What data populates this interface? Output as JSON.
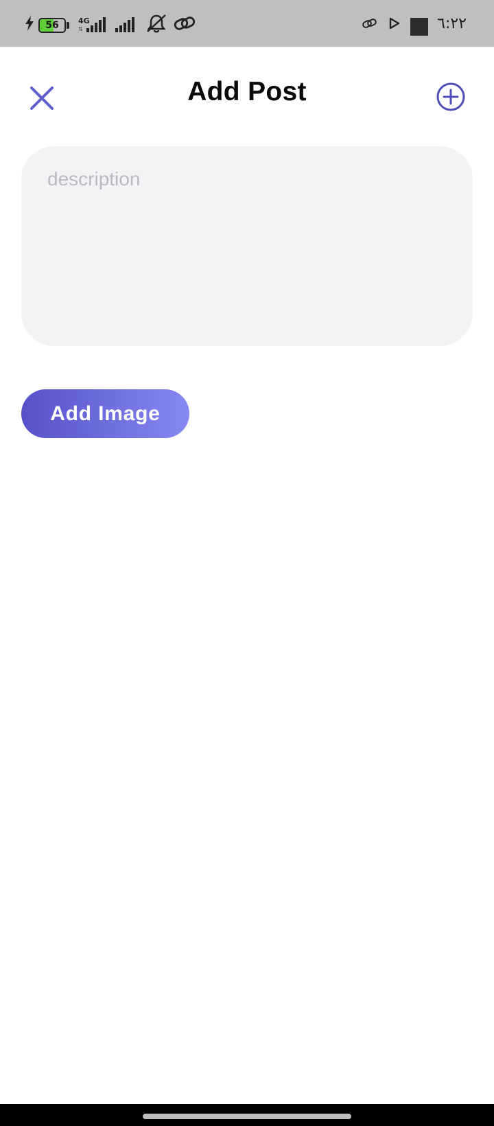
{
  "status_bar": {
    "battery_level": "56",
    "battery_fraction": 0.56,
    "network_type": "4G",
    "clock": "٦:٢٢",
    "icons": [
      "charging-bolt-icon",
      "battery-icon",
      "signal-icon",
      "signal-icon",
      "bell-muted-icon",
      "link-icon",
      "link-icon",
      "play-icon",
      "square-icon"
    ]
  },
  "header": {
    "title": "Add Post",
    "close_icon": "close-icon",
    "add_icon": "plus-circle-icon"
  },
  "form": {
    "description_placeholder": "description",
    "description_value": "",
    "add_image_label": "Add Image"
  },
  "colors": {
    "accent": "#5552c9",
    "accent_light": "#8688f1",
    "field_bg": "#f2f3f5",
    "status_bar_bg": "#bfbfbf"
  }
}
